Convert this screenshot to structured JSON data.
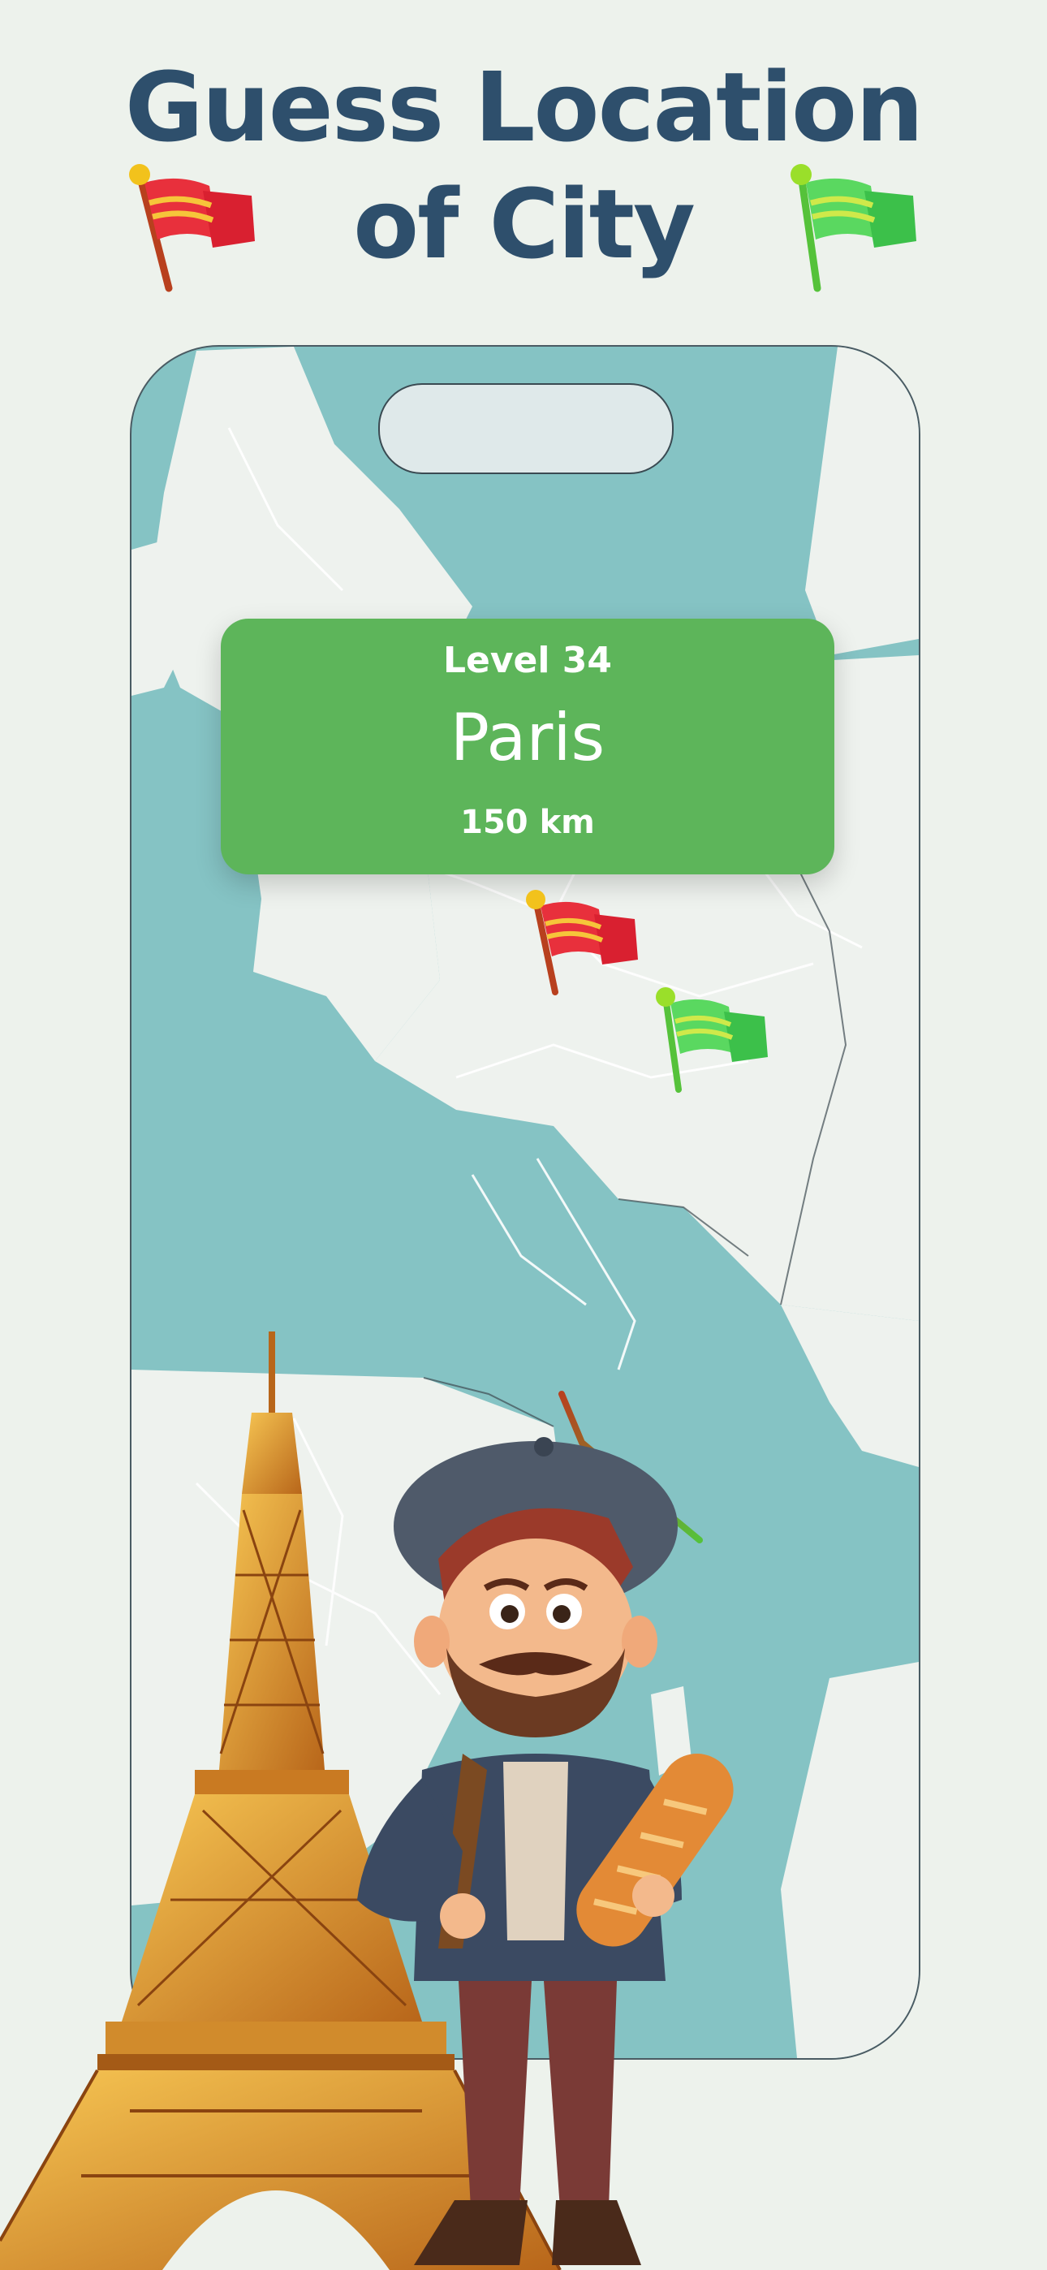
{
  "headline": {
    "line1": "Guess Location",
    "line2": "of City"
  },
  "game": {
    "level_label": "Level 34",
    "city_name": "Paris",
    "distance_label": "150 km"
  },
  "icons": {
    "guess_flag": "red-flag-icon",
    "target_flag": "green-flag-icon"
  },
  "colors": {
    "background": "#edf2ec",
    "headline": "#2e4f6c",
    "card": "#5db55a",
    "sea": "#85c3c4",
    "land": "#eef2ee",
    "guess_flag": "#e83040",
    "target_flag": "#3fcc55"
  }
}
